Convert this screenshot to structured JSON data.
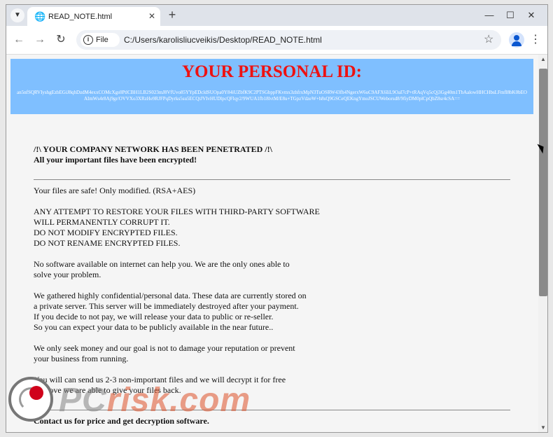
{
  "browser": {
    "tab_title": "READ_NOTE.html",
    "site_info_label": "File",
    "url": "C:/Users/karolisliucveikis/Desktop/READ_NOTE.html"
  },
  "icons": {
    "tab_search": "chevron-down-icon",
    "tab_favicon": "globe-icon",
    "tab_close": "close-icon",
    "new_tab": "plus-icon",
    "minimize": "minimize-icon",
    "maximize": "maximize-icon",
    "close_window": "close-icon",
    "back": "arrow-left-icon",
    "forward": "arrow-right-icon",
    "reload": "reload-icon",
    "site_info": "info-icon",
    "bookmark": "star-icon",
    "profile": "avatar-icon",
    "menu": "kebab-icon"
  },
  "colors": {
    "banner_bg": "#7fbfff",
    "banner_title": "#ee1111",
    "page_bg": "#f5f5f5"
  },
  "note": {
    "banner_title": "YOUR PERSONAL ID:",
    "personal_id": "an5nfSQRVIyshgEzbEGiJ8qhDzdM4exxCOMcXgs0PtlCBH1LB2S023mJ8VfUvo85YYpEDcldSUOpa0Y84iUZbfK9C2PTSGbppFKvmx3zhfrxMpN3TuOSRW43fh4NgerxW6uC9AFX6IiL9OaI7cP+tRAqVq5cQj3Gg40m1TbAalowHHCHbsLFmfl8bK0bEOAImWs4r8Aj9gr/OVVXo3XRzHe9RJFPqDyrks5su5ECQtJVIvHUDlpcQFlqy2/9WUA1fb18lvtM/E8u+TGpzVdzeW+h8sQ9GSCeQEKngYmoJSCUWeborsd8/9fiyDM0plCpQbZ8sr4cSA=="
  },
  "message": {
    "headline1": "/!\\ YOUR COMPANY NETWORK HAS BEEN PENETRATED /!\\",
    "headline2": "All your important files have been encrypted!",
    "p1": "Your files are safe! Only modified. (RSA+AES)",
    "p2_l1": "ANY ATTEMPT TO RESTORE YOUR FILES WITH THIRD-PARTY SOFTWARE",
    "p2_l2": "WILL PERMANENTLY CORRUPT IT.",
    "p2_l3": "DO NOT MODIFY ENCRYPTED FILES.",
    "p2_l4": "DO NOT RENAME ENCRYPTED FILES.",
    "p3_l1": "No software available on internet can help you. We are the only ones able to",
    "p3_l2": "solve your problem.",
    "p4_l1": "We gathered highly confidential/personal data. These data are currently stored on",
    "p4_l2": "a private server. This server will be immediately destroyed after your payment.",
    "p4_l3": "If you decide to not pay, we will release your data to public or re-seller.",
    "p4_l4": "So you can expect your data to be publicly available in the near future..",
    "p5_l1": "We only seek money and our goal is not to damage your reputation or prevent",
    "p5_l2": "your business from running.",
    "p6_l1": "You will can send us 2-3 non-important files and we will decrypt it for free",
    "p6_l2": "to prove we are able to give your files back.",
    "contact": "Contact us for price and get decryption software."
  },
  "watermark": {
    "pc": "PC",
    "risk": "risk.com"
  }
}
